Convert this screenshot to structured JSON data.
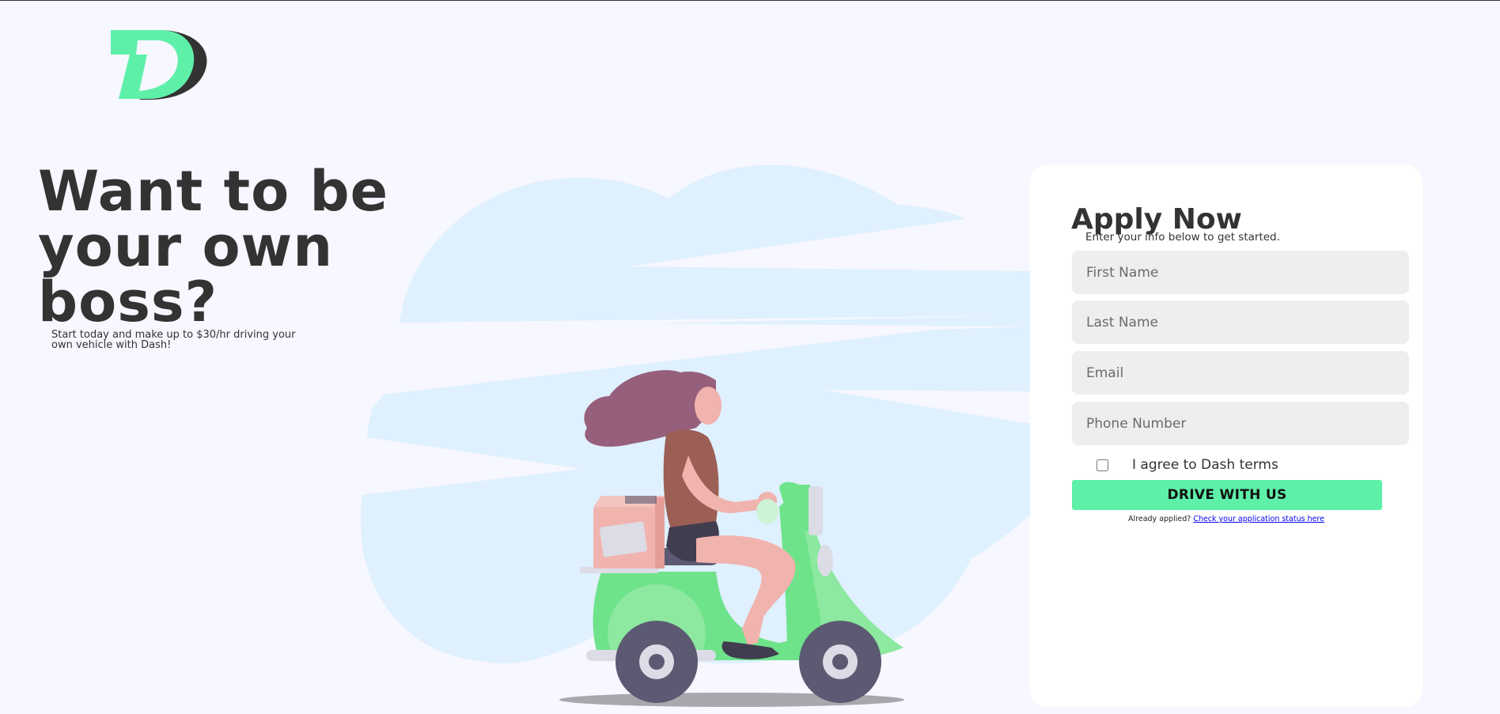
{
  "brand": {
    "logo_letter": "D",
    "colors": {
      "green": "#5ef0a9",
      "dark": "#333333",
      "background": "#f6f7ff"
    }
  },
  "hero": {
    "title": "Want to be your own boss?",
    "subtitle": "Start today and make up to $30/hr driving your own vehicle with Dash!"
  },
  "form": {
    "title": "Apply Now",
    "subtitle": "Enter your info below to get started.",
    "first_name_placeholder": "First Name",
    "last_name_placeholder": "Last Name",
    "email_placeholder": "Email",
    "phone_placeholder": "Phone Number",
    "terms_label": "I agree to Dash terms",
    "terms_checked": false,
    "submit_label": "DRIVE WITH US",
    "already_applied_text": "Already applied?",
    "status_link_text": "Check your application status here"
  },
  "illustration": {
    "name": "woman-riding-scooter-delivery-illustration"
  }
}
